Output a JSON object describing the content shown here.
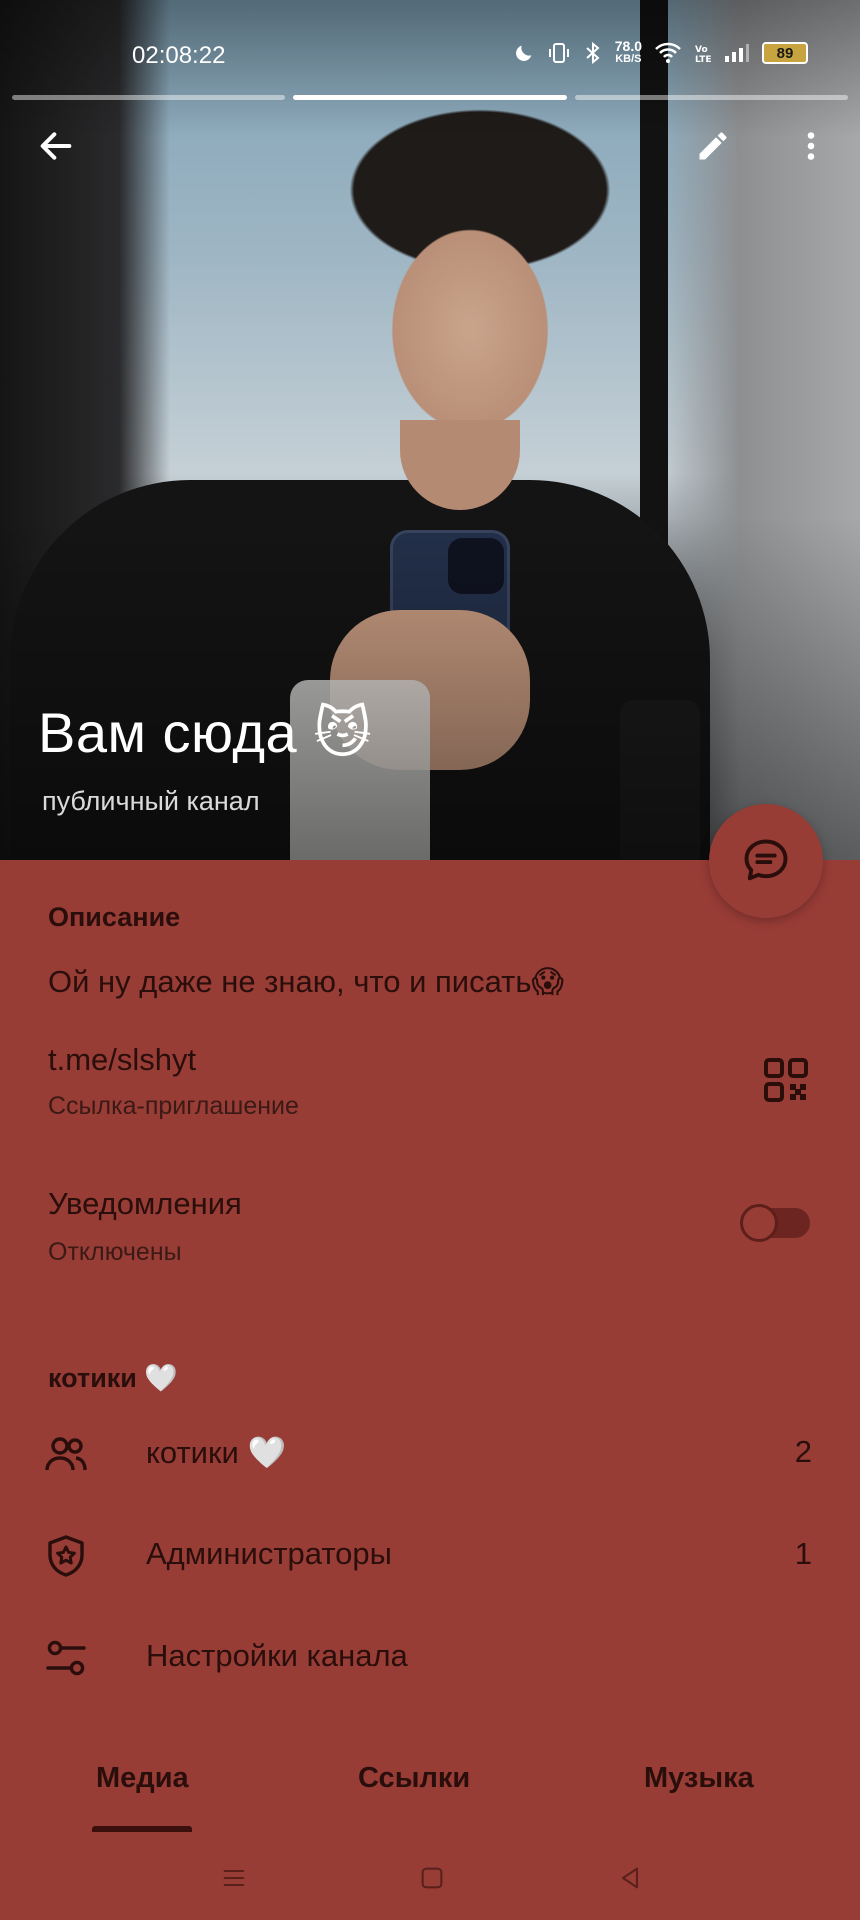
{
  "status_bar": {
    "time": "02:08:22",
    "net_speed_value": "78.0",
    "net_speed_unit": "KB/S",
    "battery": "89"
  },
  "story_progress": {
    "segments": 3,
    "active_index": 1
  },
  "header": {
    "title": "Вам сюда 😼",
    "subtitle": "публичный канал"
  },
  "description": {
    "heading": "Описание",
    "text": "Ой ну даже не знаю, что и писать😱"
  },
  "invite_link": {
    "url": "t.me/slshyt",
    "caption": "Ссылка-приглашение"
  },
  "notifications": {
    "label": "Уведомления",
    "state": "Отключены",
    "enabled": false
  },
  "group_section": {
    "heading": "котики 🤍"
  },
  "menu": [
    {
      "icon": "users-icon",
      "label": "котики 🤍",
      "count": "2"
    },
    {
      "icon": "shield-star-icon",
      "label": "Администраторы",
      "count": "1"
    },
    {
      "icon": "sliders-icon",
      "label": "Настройки канала",
      "count": ""
    }
  ],
  "tabs": [
    {
      "label": "Медиа",
      "active": true
    },
    {
      "label": "Ссылки",
      "active": false
    },
    {
      "label": "Музыка",
      "active": false
    }
  ],
  "colors": {
    "background": "#983c36",
    "text": "#2a0e0b",
    "battery": "#c7a43f"
  }
}
